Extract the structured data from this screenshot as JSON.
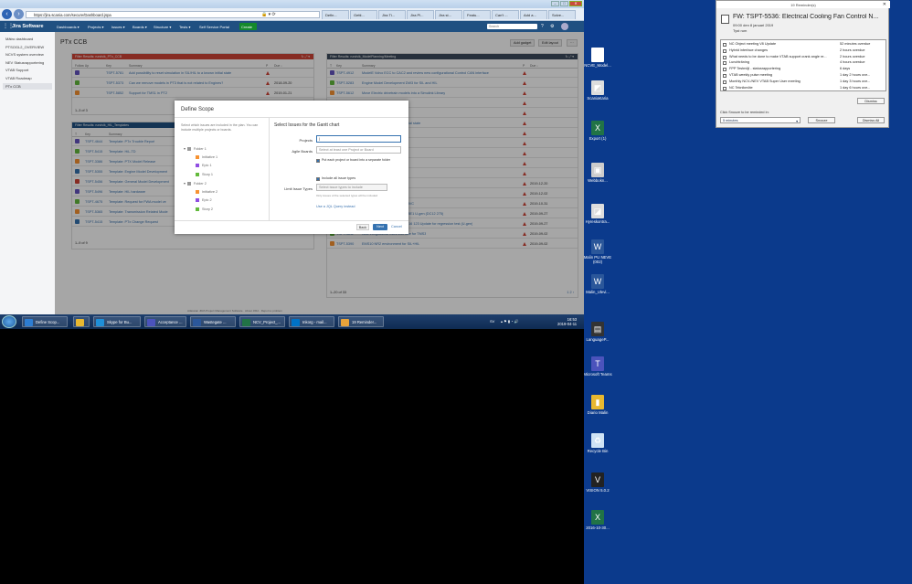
{
  "browser": {
    "url": "https://jira.scania.com/secure/Dashboard.jspa",
    "tabs": [
      "Defin...",
      "Getti...",
      "Jira Ti...",
      "Jira Pl...",
      "Jira st...",
      "Featu...",
      "Can't ...",
      "Add a...",
      "Solve..."
    ]
  },
  "jira": {
    "logo": "Jira Software",
    "nav": [
      "Dashboards ▾",
      "Projects ▾",
      "Issues ▾",
      "Boards ▾",
      "Structure ▾",
      "Tests ▾",
      "Self Service Portal"
    ],
    "create": "Create",
    "search_placeholder": "Search"
  },
  "sidebar": [
    "Mätro dashboard",
    "PTSOGL2_OVERVIEW",
    "NCVS system overview",
    "NEV Statusrapportering",
    "VTAB Support",
    "VTAB Roadmap",
    "PTx CCB"
  ],
  "page": {
    "title": "PTx CCB",
    "add_gadget": "Add gadget",
    "edit_layout": "Edit layout",
    "more": "···"
  },
  "gadget1": {
    "header": "Filter Results: rundvik_PTx_CCB",
    "cols": [
      "Follow Up",
      "Key",
      "Summary",
      "P",
      "Due ↓"
    ],
    "rows": [
      {
        "key": "TSPT-5781",
        "summary": "Add possibility to reset simulation in SIL/HIL to a known initial state",
        "due": ""
      },
      {
        "key": "TSPT-5373",
        "summary": "Can we remove models in PT3 that is not related to Engines?",
        "due": "2018-09-20"
      },
      {
        "key": "TSPT-5852",
        "summary": "Support for TMS1 in PT2",
        "due": "2019-01-21"
      }
    ],
    "footer": "1–3 of 3"
  },
  "gadget2": {
    "header": "Filter Results: rundvik_HIL_Templates",
    "cols": [
      "T",
      "Key",
      "Summary"
    ],
    "rows": [
      {
        "key": "TSPT-4644",
        "summary": "Template: PTx Trouble Report"
      },
      {
        "key": "TSPT-5415",
        "summary": "Template: HiL-TD"
      },
      {
        "key": "TSPT-3386",
        "summary": "Template: PTX Model Release"
      },
      {
        "key": "TSPT-5355",
        "summary": "Template: Engine Model Development"
      },
      {
        "key": "TSPT-5456",
        "summary": "Template: General Model Development"
      },
      {
        "key": "TSPT-5496",
        "summary": "Template: HIL hardware"
      },
      {
        "key": "TSPT-4675",
        "summary": "Template: Request for FWA model ve"
      },
      {
        "key": "TSPT-5365",
        "summary": "Template: Transmission Related Mode"
      },
      {
        "key": "TSPT-5415",
        "summary": "Template: PTx Change Request"
      }
    ],
    "footer": "1–9 of 9"
  },
  "gadget3": {
    "header": "Filter Results: rundvik_ModelPlanning/Meeting",
    "cols": [
      "T",
      "Key",
      "Summary",
      "P",
      "Due ↓"
    ],
    "rows": [
      {
        "key": "TSPT-4912",
        "summary": "ModelE Volvo ECC to CAC2 and review new configurational Control CAN interface",
        "due": ""
      },
      {
        "key": "TSPT-5283",
        "summary": "Engine Model Development DW3 for SIL and HIL",
        "due": ""
      },
      {
        "key": "TSPT-5612",
        "summary": "Move Electric drivetrain models into a Simulink Library",
        "due": ""
      },
      {
        "key": "",
        "summary": "Development PTx DC16 123",
        "due": ""
      },
      {
        "key": "",
        "summary": "PT in SIL & HIL",
        "due": ""
      },
      {
        "key": "",
        "summary": "ation in SIL/HIL to a known initial state",
        "due": ""
      },
      {
        "key": "",
        "summary": "atment from Basiliaj",
        "due": ""
      },
      {
        "key": "",
        "summary": "n to HIL and SIL",
        "due": ""
      },
      {
        "key": "",
        "summary": "ation handling",
        "due": ""
      },
      {
        "key": "",
        "summary": "",
        "due": ""
      },
      {
        "key": "",
        "summary": "model status in VTAB",
        "due": ""
      },
      {
        "key": "",
        "summary": "Model Development for HIL",
        "due": "2019-12-20"
      },
      {
        "key": "",
        "summary": "evelopment for HIL",
        "due": "2019-12-02"
      },
      {
        "key": "TSPT-5681",
        "summary": "Disable scripts system using HVC",
        "due": "2019-10-31"
      },
      {
        "key": "TSPT-5640",
        "summary": "Engine Model Development D8E1 U-gen (DC12 275)",
        "due": "2019-09-27"
      },
      {
        "key": "TSPT-5511",
        "summary": "EMS10 Engine Model PTx DC16 123 Update for regression test (U-gen)",
        "due": "2019-09-27"
      },
      {
        "key": "TSPT-4611",
        "summary": "New Longitudinal CAN interface for TMS3",
        "due": "2019-09-02"
      },
      {
        "key": "TSPT-5390",
        "summary": "EMS10 NR2 environment for SIL+HIL",
        "due": "2019-09-02"
      }
    ],
    "footer": "1–20 of 33",
    "pages": "1 2 ›"
  },
  "dialog": {
    "title": "Define Scope",
    "left_desc": "Select which issues are included in the plan. You can include multiple projects or boards.",
    "tree": [
      {
        "label": "Folder 1",
        "level": 0,
        "color": "#999999"
      },
      {
        "label": "Initiative 1",
        "level": 1,
        "color": "#f79232"
      },
      {
        "label": "Epic 1",
        "level": 1,
        "color": "#904ee2"
      },
      {
        "label": "Story 1",
        "level": 1,
        "color": "#63ba3c"
      },
      {
        "label": "Folder 2",
        "level": 0,
        "color": "#999999"
      },
      {
        "label": "Initiative 2",
        "level": 1,
        "color": "#f79232"
      },
      {
        "label": "Epic 2",
        "level": 1,
        "color": "#904ee2"
      },
      {
        "label": "Story 2",
        "level": 1,
        "color": "#63ba3c"
      }
    ],
    "right_title": "Select Issues for the Gantt chart",
    "projects_label": "Projects",
    "agile_label": "Agile Boards",
    "agile_placeholder": "Select at least one Project or Board",
    "put_folder": "Put each project or board into a separate folder",
    "include_all": "Include all issue types",
    "limit_label": "Limit Issue Types",
    "limit_placeholder": "Select issue types to include",
    "limit_hint": "Only issues of the selected types will be included",
    "jql_link": "Use a JQL Query instead",
    "back": "Back",
    "next": "Next",
    "cancel": "Cancel"
  },
  "footer_text": "Atlassian JIRA Project Management Software · About JIRA · Report a problem",
  "taskbar": {
    "items": [
      {
        "label": "Define Scop...",
        "color": "#2d7dd2"
      },
      {
        "label": "",
        "color": "#e8b830"
      },
      {
        "label": "Skype for Bu...",
        "color": "#1f8fd8"
      },
      {
        "label": "Acceptance ...",
        "color": "#4b53bc"
      },
      {
        "label": "Wastegate ...",
        "color": "#2b579a"
      },
      {
        "label": "NCV_Project_...",
        "color": "#217346"
      },
      {
        "label": "Inkorg - mail...",
        "color": "#0072c6"
      },
      {
        "label": "19 Reminder...",
        "color": "#e8a33a"
      }
    ],
    "lang": "SV",
    "time": "16:53",
    "date": "2019-04-11"
  },
  "reminder": {
    "title": "19 Reminder(s)",
    "subject": "FW: TSPT-5536: Electrical Cooling Fan Control N...",
    "when": "09:00 den 8 januari 2019",
    "place": "Tyst rum",
    "items": [
      {
        "name": "NC Object meeting V8 Update",
        "due": "52 minutes overdue"
      },
      {
        "name": "Hybrid interface changes",
        "due": "2 hours overdue"
      },
      {
        "name": "What needs to be done to make VTAB support crank angle re...",
        "due": "2 hours overdue"
      },
      {
        "name": "Lunchträning",
        "due": "4 hours overdue"
      },
      {
        "name": "FPP Testmöjl - statusrapportering",
        "due": "6 days"
      },
      {
        "name": "VTAB weekly pulse meeting",
        "due": "1 day 2 hours ove..."
      },
      {
        "name": "Monthly NCV-/NEV VTAB Super User meeting",
        "due": "1 day 3 hours ove..."
      },
      {
        "name": "NC Teknikmöte",
        "due": "1 day 6 hours ove..."
      }
    ],
    "dismiss": "Dismiss",
    "snooze_label": "Click Snooze to be reminded in:",
    "snooze_value": "5 minutes",
    "snooze": "Snooze",
    "dismiss_all": "Dismiss All"
  },
  "desktop_icons": [
    {
      "label": "NCVE_Model...",
      "color": "#ffffff",
      "glyph": "▦"
    },
    {
      "label": "ScaniaKaria",
      "color": "#dddddd",
      "glyph": "◩"
    },
    {
      "label": "Export (1)",
      "color": "#217346",
      "glyph": "X"
    },
    {
      "label": "Webbokn...",
      "color": "#cccccc",
      "glyph": "▣"
    },
    {
      "label": "Hyreskontra...",
      "color": "#dddddd",
      "glyph": "◪"
    },
    {
      "label": "Malin PU NEVE (002)",
      "color": "#2b579a",
      "glyph": "W"
    },
    {
      "label": "Malin_Ulevi...",
      "color": "#2b579a",
      "glyph": "W"
    },
    {
      "label": "LanguageP...",
      "color": "#333333",
      "glyph": "▤"
    },
    {
      "label": "Microsoft Teams",
      "color": "#4b53bc",
      "glyph": "T"
    },
    {
      "label": "Diario Malin",
      "color": "#e8b830",
      "glyph": "▮"
    },
    {
      "label": "Recycle Bin",
      "color": "#cfe3f5",
      "glyph": "♻"
    },
    {
      "label": "VISION 5.0.2",
      "color": "#222222",
      "glyph": "V"
    },
    {
      "label": "2016-10-30...",
      "color": "#217346",
      "glyph": "X"
    }
  ]
}
